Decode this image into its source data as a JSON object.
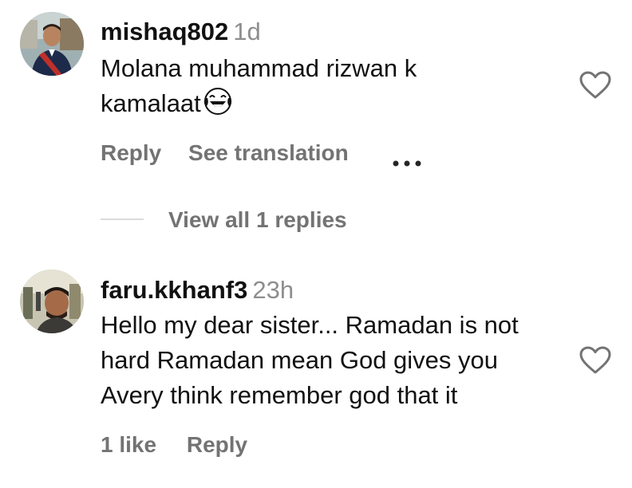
{
  "comments": [
    {
      "username": "mishaq802",
      "timestamp": "1d",
      "avatar_icon": "profile-photo-boy-with-sash",
      "text_lines": [
        "Molana muhammad rizwan k",
        "kamalaat"
      ],
      "emoji": "face-with-tears-of-joy-icon",
      "actions": {
        "reply_label": "Reply",
        "translate_label": "See translation",
        "more_icon": "more-options-icon"
      },
      "like_icon": "heart-outline-icon",
      "view_replies_label": "View all 1 replies"
    },
    {
      "username": "faru.kkhanf3",
      "timestamp": "23h",
      "avatar_icon": "profile-photo-man-selfie",
      "text_lines": [
        "Hello my dear sister... Ramadan is not",
        "hard Ramadan mean God gives you",
        "Avery think remember god that it"
      ],
      "actions": {
        "likes_label": "1 like",
        "reply_label": "Reply"
      },
      "like_icon": "heart-outline-icon"
    }
  ],
  "colors": {
    "text": "#111111",
    "secondary": "#737373",
    "timestamp": "#8e8e8e",
    "divider": "#dbdbdb"
  }
}
